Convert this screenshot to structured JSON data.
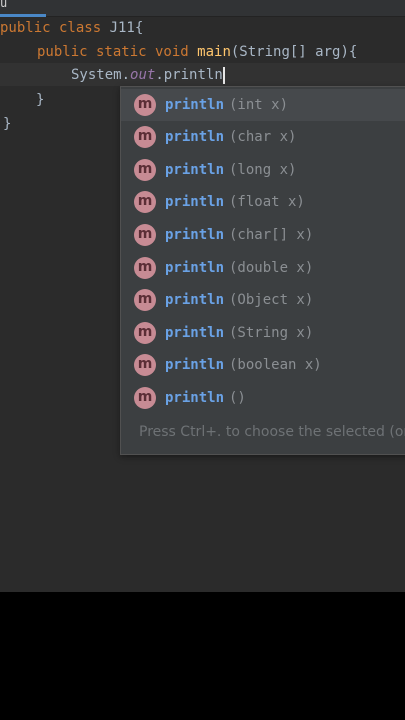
{
  "tab": {
    "label": "u"
  },
  "code": {
    "line1": {
      "kw": "public class ",
      "name": "J11{"
    },
    "line2": {
      "kw": "public static void ",
      "method": "main",
      "rest": "(String[] arg){"
    },
    "line3": {
      "obj": "System.",
      "field": "out",
      "call": ".println"
    },
    "line4": "}",
    "line5": "}"
  },
  "completion": {
    "items": [
      {
        "name": "println",
        "params": "(int x)",
        "icon": "method-icon"
      },
      {
        "name": "println",
        "params": "(char x)",
        "icon": "method-icon"
      },
      {
        "name": "println",
        "params": "(long x)",
        "icon": "method-icon"
      },
      {
        "name": "println",
        "params": "(float x)",
        "icon": "method-icon"
      },
      {
        "name": "println",
        "params": "(char[] x)",
        "icon": "method-icon"
      },
      {
        "name": "println",
        "params": "(double x)",
        "icon": "method-icon"
      },
      {
        "name": "println",
        "params": "(Object x)",
        "icon": "method-icon"
      },
      {
        "name": "println",
        "params": "(String x)",
        "icon": "method-icon"
      },
      {
        "name": "println",
        "params": "(boolean x)",
        "icon": "method-icon"
      },
      {
        "name": "println",
        "params": "()",
        "icon": "method-icon"
      }
    ],
    "icon_letter": "m",
    "hint": "Press Ctrl+. to choose the selected (or fir"
  },
  "colors": {
    "editor_bg": "#2b2b2b",
    "keyword": "#cc7832",
    "method": "#ffc66d",
    "popup_bg": "#3c3f41",
    "popup_name": "#6aa2e6",
    "method_icon": "#c78b94"
  }
}
